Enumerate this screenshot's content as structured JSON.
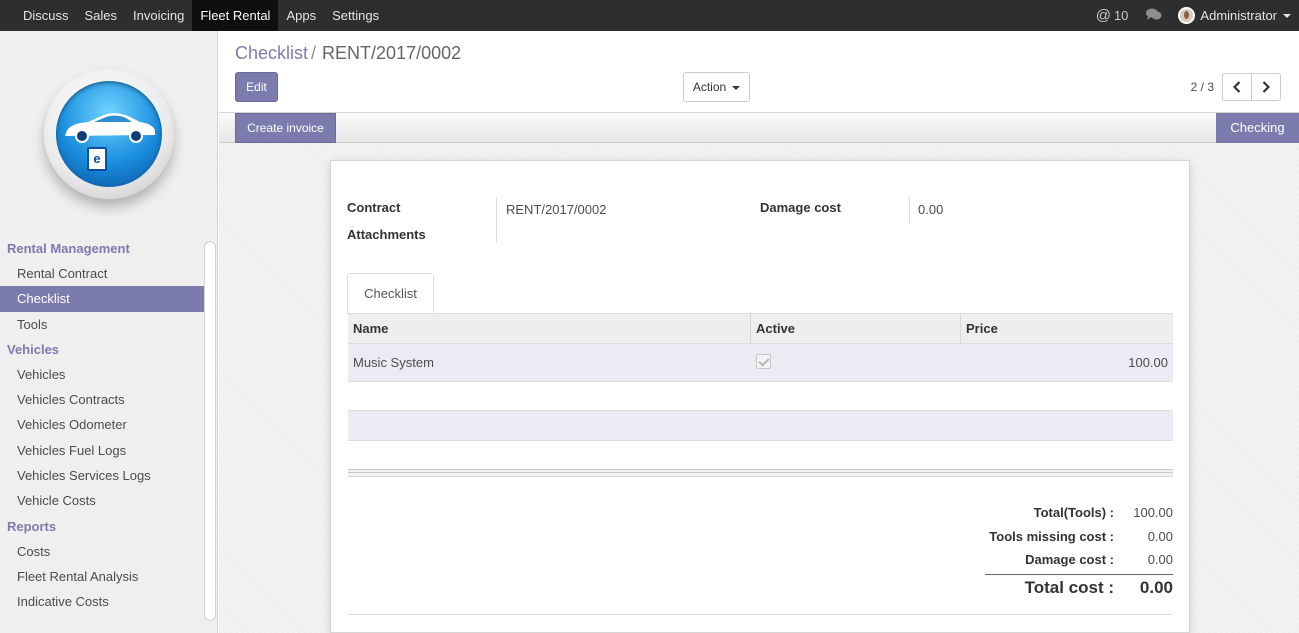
{
  "topbar": {
    "menu": [
      {
        "label": "Discuss",
        "active": false
      },
      {
        "label": "Sales",
        "active": false
      },
      {
        "label": "Invoicing",
        "active": false
      },
      {
        "label": "Fleet Rental",
        "active": true
      },
      {
        "label": "Apps",
        "active": false
      },
      {
        "label": "Settings",
        "active": false
      }
    ],
    "messages_count": "10",
    "user_name": "Administrator"
  },
  "sidebar": {
    "sections": [
      {
        "title": "Rental Management",
        "items": [
          "Rental Contract",
          "Checklist",
          "Tools"
        ]
      },
      {
        "title": "Vehicles",
        "items": [
          "Vehicles",
          "Vehicles Contracts",
          "Vehicles Odometer",
          "Vehicles Fuel Logs",
          "Vehicles Services Logs",
          "Vehicle Costs"
        ]
      },
      {
        "title": "Reports",
        "items": [
          "Costs",
          "Fleet Rental Analysis",
          "Indicative Costs"
        ]
      }
    ],
    "active_item": "Checklist"
  },
  "control_panel": {
    "breadcrumb_parent": "Checklist",
    "breadcrumb_separator": "/",
    "breadcrumb_current": "RENT/2017/0002",
    "edit_label": "Edit",
    "action_label": "Action",
    "pager_value": "2 / 3"
  },
  "statusbar": {
    "create_invoice_label": "Create invoice",
    "stage": "Checking"
  },
  "form": {
    "contract_label": "Contract",
    "contract_value": "RENT/2017/0002",
    "attachments_label": "Attachments",
    "damage_cost_label": "Damage cost",
    "damage_cost_value": "0.00",
    "tab_label": "Checklist",
    "columns": [
      "Name",
      "Active",
      "Price"
    ],
    "rows": [
      {
        "name": "Music System",
        "active": true,
        "price": "100.00"
      }
    ],
    "totals": {
      "total_tools_label": "Total(Tools) :",
      "total_tools_value": "100.00",
      "tools_missing_label": "Tools missing cost :",
      "tools_missing_value": "0.00",
      "damage_label": "Damage cost :",
      "damage_value": "0.00",
      "total_cost_label": "Total cost :",
      "total_cost_value": "0.00"
    }
  },
  "colors": {
    "accent": "#7c7bad",
    "topbar": "#2e2e2e"
  }
}
